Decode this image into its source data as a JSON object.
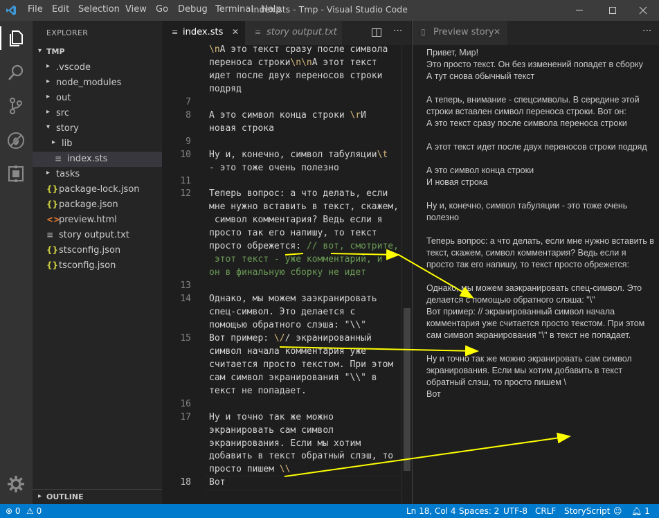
{
  "window": {
    "title": "index.sts - Tmp - Visual Studio Code",
    "menu": [
      "File",
      "Edit",
      "Selection",
      "View",
      "Go",
      "Debug",
      "Terminal",
      "Help"
    ]
  },
  "sidebar": {
    "header": "EXPLORER",
    "root": "TMP",
    "items": [
      {
        "label": ".vscode",
        "kind": "folder",
        "expanded": false
      },
      {
        "label": "node_modules",
        "kind": "folder",
        "expanded": false
      },
      {
        "label": "out",
        "kind": "folder",
        "expanded": false
      },
      {
        "label": "src",
        "kind": "folder",
        "expanded": false
      },
      {
        "label": "story",
        "kind": "folder",
        "expanded": true
      },
      {
        "label": "lib",
        "kind": "folder",
        "expanded": false
      },
      {
        "label": "index.sts",
        "kind": "sts",
        "selected": true
      },
      {
        "label": "tasks",
        "kind": "folder",
        "expanded": false
      },
      {
        "label": "package-lock.json",
        "kind": "json"
      },
      {
        "label": "package.json",
        "kind": "json"
      },
      {
        "label": "preview.html",
        "kind": "html"
      },
      {
        "label": "story output.txt",
        "kind": "txt"
      },
      {
        "label": "stsconfig.json",
        "kind": "json"
      },
      {
        "label": "tsconfig.json",
        "kind": "json"
      }
    ],
    "outline": "OUTLINE"
  },
  "editor": {
    "tabs": [
      {
        "label": "index.sts",
        "active": true
      },
      {
        "label": "story output.txt",
        "active": false
      }
    ],
    "lines": [
      {
        "num": "",
        "segments": [
          {
            "t": "\\n",
            "c": "esc"
          },
          {
            "t": "А это текст сразу после символа"
          }
        ]
      },
      {
        "num": "",
        "segments": [
          {
            "t": "переноса строки"
          },
          {
            "t": "\\n\\n",
            "c": "esc"
          },
          {
            "t": "А этот текст"
          }
        ]
      },
      {
        "num": "",
        "segments": [
          {
            "t": "идет после двух переносов строки"
          }
        ]
      },
      {
        "num": "",
        "segments": [
          {
            "t": "подряд"
          }
        ]
      },
      {
        "num": "7",
        "segments": []
      },
      {
        "num": "8",
        "segments": [
          {
            "t": "А это символ конца строки "
          },
          {
            "t": "\\r",
            "c": "esc"
          },
          {
            "t": "И"
          }
        ]
      },
      {
        "num": "",
        "segments": [
          {
            "t": "новая строка"
          }
        ]
      },
      {
        "num": "9",
        "segments": []
      },
      {
        "num": "10",
        "segments": [
          {
            "t": "Ну и, конечно, символ табуляции"
          },
          {
            "t": "\\t",
            "c": "esc"
          }
        ]
      },
      {
        "num": "",
        "segments": [
          {
            "t": "- это тоже очень полезно"
          }
        ]
      },
      {
        "num": "11",
        "segments": []
      },
      {
        "num": "12",
        "segments": [
          {
            "t": "Теперь вопрос: а что делать, если"
          }
        ]
      },
      {
        "num": "",
        "segments": [
          {
            "t": "мне нужно вставить в текст, скажем,"
          }
        ]
      },
      {
        "num": "",
        "segments": [
          {
            "t": " символ комментария? Ведь если я"
          }
        ]
      },
      {
        "num": "",
        "segments": [
          {
            "t": "просто так его напишу, то текст"
          }
        ]
      },
      {
        "num": "",
        "segments": [
          {
            "t": "просто обрежется: "
          },
          {
            "t": "// вот, смотрите,",
            "c": "cmt"
          }
        ]
      },
      {
        "num": "",
        "segments": [
          {
            "t": " этот текст - уже комментарий, и",
            "c": "cmt"
          }
        ]
      },
      {
        "num": "",
        "segments": [
          {
            "t": "он в финальную сборку не идет",
            "c": "cmt"
          }
        ]
      },
      {
        "num": "13",
        "segments": []
      },
      {
        "num": "14",
        "segments": [
          {
            "t": "Однако, мы можем заэкранировать"
          }
        ]
      },
      {
        "num": "",
        "segments": [
          {
            "t": "спец-символ. Это делается с"
          }
        ]
      },
      {
        "num": "",
        "segments": [
          {
            "t": "помощью обратного слэша: \"\\\\\""
          }
        ]
      },
      {
        "num": "15",
        "segments": [
          {
            "t": "Вот пример: "
          },
          {
            "t": "\\/",
            "c": "esc"
          },
          {
            "t": "/ экранированный"
          }
        ]
      },
      {
        "num": "",
        "segments": [
          {
            "t": "символ начала комментария уже"
          }
        ]
      },
      {
        "num": "",
        "segments": [
          {
            "t": "считается просто текстом. При этом"
          }
        ]
      },
      {
        "num": "",
        "segments": [
          {
            "t": "сам символ экранирования \"\\\\\" в"
          }
        ]
      },
      {
        "num": "",
        "segments": [
          {
            "t": "текст не попадает."
          }
        ]
      },
      {
        "num": "16",
        "segments": []
      },
      {
        "num": "17",
        "segments": [
          {
            "t": "Ну и точно так же можно"
          }
        ]
      },
      {
        "num": "",
        "segments": [
          {
            "t": "экранировать сам символ"
          }
        ]
      },
      {
        "num": "",
        "segments": [
          {
            "t": "экранирования. Если мы хотим"
          }
        ]
      },
      {
        "num": "",
        "segments": [
          {
            "t": "добавить в текст обратный слэш, то"
          }
        ]
      },
      {
        "num": "",
        "segments": [
          {
            "t": "просто пишем "
          },
          {
            "t": "\\\\",
            "c": "esc"
          }
        ]
      },
      {
        "num": "18",
        "segments": [
          {
            "t": "Вот"
          }
        ],
        "current": true
      }
    ]
  },
  "preview": {
    "tab_label": "Preview story",
    "text": "Привет, Мир!\nЭто просто текст. Он без изменений попадет в сборку\nА тут снова обычный текст\n\nА теперь, внимание - спецсимволы. В середине этой строки вставлен символ переноса строки. Вот он:\nА это текст сразу после символа переноса строки\n\nА этот текст идет после двух переносов строки подряд\n\nА это символ конца строки\nИ новая строка\n\nНу и, конечно, символ табуляции         - это тоже очень полезно\n\nТеперь вопрос: а что делать, если мне нужно вставить в текст, скажем, символ комментария? Ведь если я просто так его напишу, то текст просто обрежется:\n\nОднако, мы можем заэкранировать спец-символ. Это делается с помощью обратного слэша: \"\\\"\nВот пример: // экранированный символ начала комментария уже считается просто текстом. При этом сам символ экранирования \"\\\" в текст не попадает.\n\nНу и точно так же можно экранировать сам символ экранирования. Если мы хотим добавить в текст обратный слэш, то просто пишем \\\nВот"
  },
  "status": {
    "errors": "0",
    "warnings": "0",
    "position": "Ln 18, Col 4",
    "spaces": "Spaces: 2",
    "encoding": "UTF-8",
    "eol": "CRLF",
    "language": "StoryScript",
    "notifications": "1"
  },
  "colors": {
    "accent": "#007acc",
    "arrow": "#ffff00",
    "escape": "#d7ba7d",
    "comment": "#6a9955"
  }
}
